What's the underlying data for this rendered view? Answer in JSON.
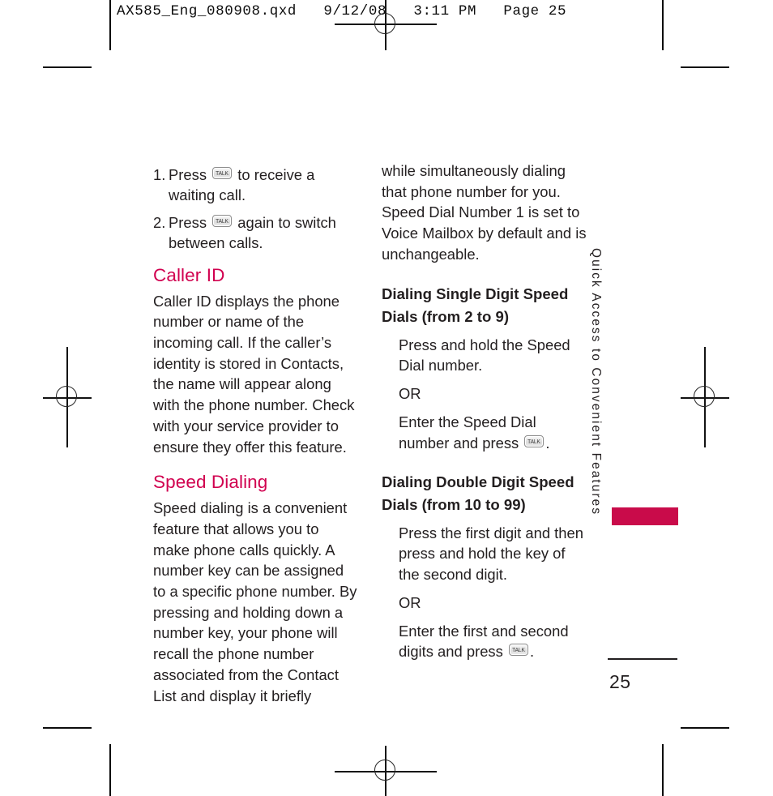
{
  "proof": {
    "header_line": "AX585_Eng_080908.qxd   9/12/08   3:11 PM   Page 25"
  },
  "colors": {
    "heading_magenta": "#d1004f",
    "tab_magenta": "#c90b4a",
    "body_text": "#231f20"
  },
  "left_column": {
    "steps": [
      {
        "num": "1.",
        "before": "Press",
        "key": "TALK",
        "after": "to receive a waiting call."
      },
      {
        "num": "2.",
        "before": "Press",
        "key": "TALK",
        "after": "again to switch between calls."
      }
    ],
    "caller_id": {
      "heading": "Caller ID",
      "body": "Caller ID displays the phone number or name of the incoming call. If the caller’s identity is stored in Contacts, the name will appear along with the phone number. Check with your service provider to ensure they offer this feature."
    },
    "speed_dialing": {
      "heading": "Speed Dialing",
      "body": "Speed dialing is a convenient feature that allows you to make phone calls quickly. A number key can be assigned to a specific phone number. By pressing and holding down a number key, your phone will recall the phone number associated from the Contact List and display it briefly"
    }
  },
  "right_column": {
    "continuation": "while simultaneously dialing that phone number for you. Speed Dial Number 1 is set to Voice Mailbox by default and is unchangeable.",
    "single_digit": {
      "heading": "Dialing Single Digit Speed Dials (from 2 to 9)",
      "step1": "Press and hold the Speed Dial number.",
      "or": "OR",
      "step2_before": "Enter the Speed Dial number and press",
      "step2_key": "TALK",
      "step2_after": "."
    },
    "double_digit": {
      "heading": "Dialing Double Digit Speed Dials (from 10 to 99)",
      "step1": "Press the first digit and then press and hold the key of the second digit.",
      "or": "OR",
      "step2_before": "Enter the first and second digits and press",
      "step2_key": "TALK",
      "step2_after": "."
    }
  },
  "side_tab": {
    "label": "Quick Access to Convenient Features"
  },
  "folio": {
    "page_number": "25"
  }
}
